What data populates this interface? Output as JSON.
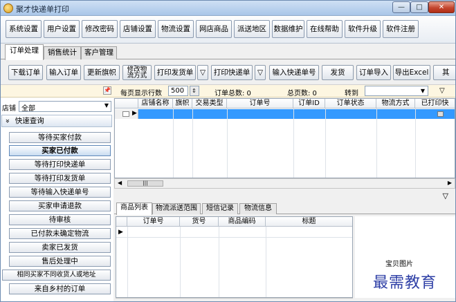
{
  "window": {
    "title": "聚才快递单打印",
    "min_glyph": "—",
    "max_glyph": "□",
    "close_glyph": "✕"
  },
  "menu": [
    "系统设置",
    "用户设置",
    "修改密码",
    "店铺设置",
    "物流设置",
    "网店商品",
    "派送地区",
    "数据维护",
    "在线帮助",
    "软件升级",
    "软件注册"
  ],
  "main_tabs": [
    "订单处理",
    "销售统计",
    "客户管理"
  ],
  "toolbar": {
    "download": "下载订单",
    "import": "输入订单",
    "update_flag": "更新旗帜",
    "change_logistics_1": "修改物",
    "change_logistics_2": "流方式",
    "print_delivery": "打印发货单",
    "print_express": "打印快递单",
    "input_tracking": "输入快递单号",
    "ship": "发货",
    "import_orders": "订单导入",
    "export_excel": "导出Excel",
    "more": "其",
    "dropdown_glyph": "▽"
  },
  "pager": {
    "rows_label": "每页显示行数",
    "rows_value": "500",
    "total_orders": "订单总数: 0",
    "total_pages": "总页数: 0",
    "goto_label": "转到",
    "pin_glyph": "📌"
  },
  "sidebar": {
    "store_label": "店铺",
    "store_value": "全部",
    "quick_query": "快速查询",
    "collapse_glyph": "«",
    "items": [
      "等待买家付款",
      "买家已付款",
      "等待打印快递单",
      "等待打印发货单",
      "等待输入快递单号",
      "买家申请退款",
      "待审核",
      "已付款未确定物流",
      "卖家已发货",
      "售后处理中",
      "相同买家不同收货人或地址",
      "来自乡村的订单"
    ],
    "selected_index": 1
  },
  "order_grid": {
    "columns": [
      "店铺名称",
      "旗帜",
      "交易类型",
      "订单号",
      "订单ID",
      "订单状态",
      "物流方式",
      "已打印快"
    ]
  },
  "detail_tabs": [
    "商品列表",
    "物流派送范围",
    "短信记录",
    "物流信息"
  ],
  "product_grid": {
    "columns": [
      "订单号",
      "货号",
      "商品编码",
      "标题"
    ]
  },
  "image_label": "宝贝图片",
  "watermark": "最需教育"
}
